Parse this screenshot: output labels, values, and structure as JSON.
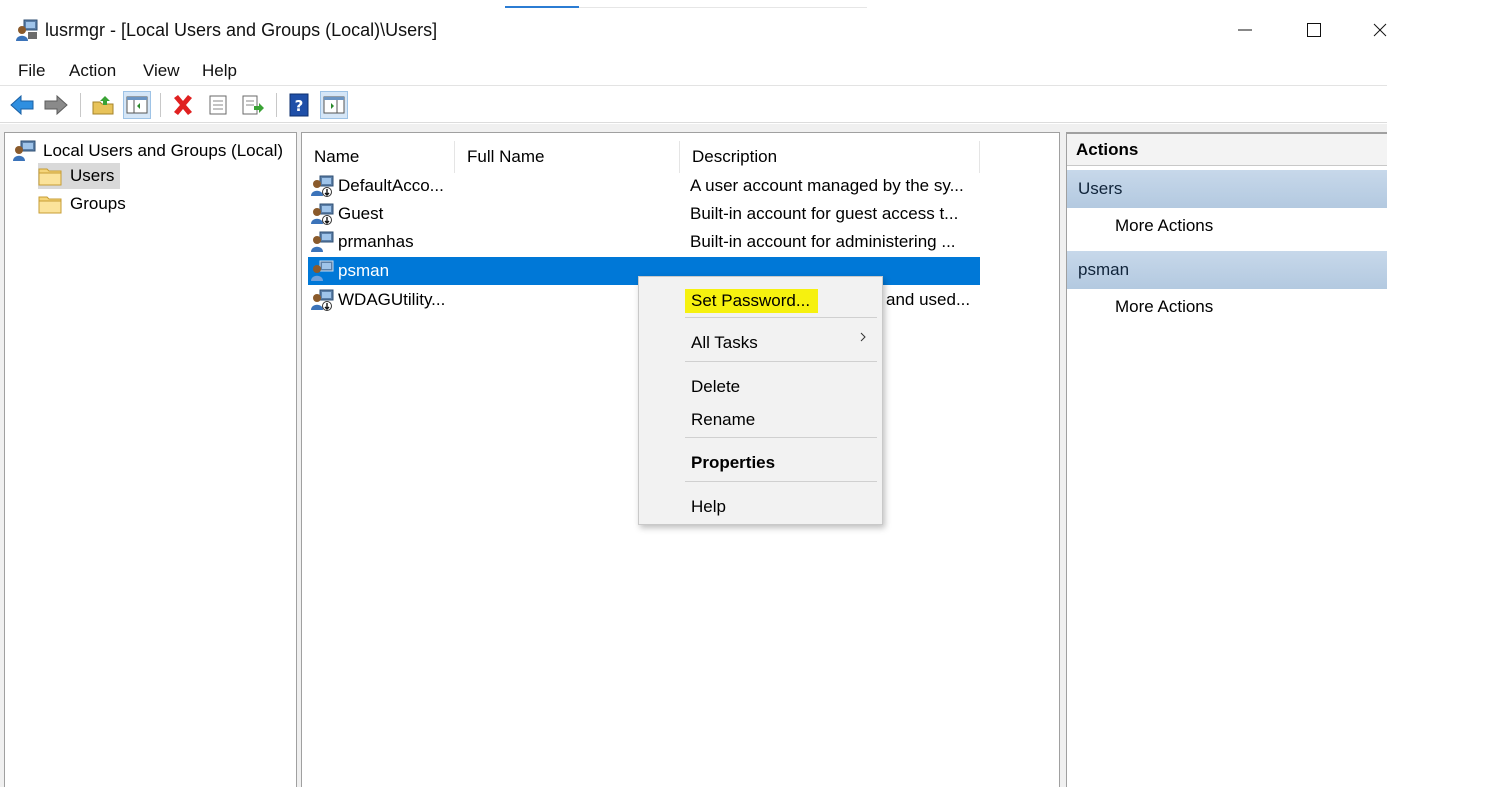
{
  "window": {
    "title": "lusrmgr - [Local Users and Groups (Local)\\Users]"
  },
  "menu": {
    "items": [
      "File",
      "Action",
      "View",
      "Help"
    ]
  },
  "toolbar": {
    "icons": [
      "back-icon",
      "forward-icon",
      "up-folder-icon",
      "show-hide-tree-icon",
      "delete-icon",
      "properties-icon",
      "export-list-icon",
      "help-icon",
      "show-hide-action-pane-icon"
    ]
  },
  "tree": {
    "root": "Local Users and Groups (Local)",
    "children": [
      "Users",
      "Groups"
    ]
  },
  "list": {
    "columns": [
      "Name",
      "Full Name",
      "Description"
    ],
    "rows": [
      {
        "name": "DefaultAcco...",
        "full_name": "",
        "description": "A user account managed by the sy..."
      },
      {
        "name": "Guest",
        "full_name": "",
        "description": "Built-in account for guest access t..."
      },
      {
        "name": "prmanhas",
        "full_name": "",
        "description": "Built-in account for administering ..."
      },
      {
        "name": "psman",
        "full_name": "",
        "description": ""
      },
      {
        "name": "WDAGUtility...",
        "full_name": "",
        "description": "and used..."
      }
    ],
    "selected_row": "psman"
  },
  "context_menu": {
    "set_password": "Set Password...",
    "all_tasks": "All Tasks",
    "delete": "Delete",
    "rename": "Rename",
    "properties": "Properties",
    "help": "Help",
    "highlight_color": "#f6f10f"
  },
  "actions": {
    "header": "Actions",
    "sections": [
      {
        "title": "Users",
        "item": "More Actions"
      },
      {
        "title": "psman",
        "item": "More Actions"
      }
    ]
  },
  "colors": {
    "selection": "#0078d7",
    "actions_section": "#b9cde2"
  }
}
